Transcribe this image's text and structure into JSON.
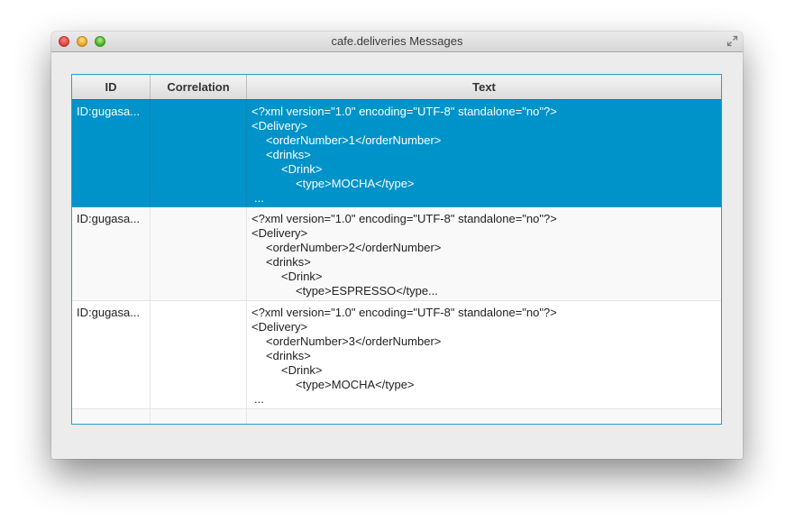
{
  "window": {
    "title": "cafe.deliveries Messages"
  },
  "table": {
    "columns": [
      "ID",
      "Correlation",
      "Text"
    ],
    "rows": [
      {
        "id": "ID:gugasa...",
        "correlation": "",
        "text_lines": [
          "<?xml version=\"1.0\" encoding=\"UTF-8\" standalone=\"no\"?>",
          "<Delivery>",
          "<orderNumber>1</orderNumber>",
          "<drinks>",
          "<Drink>",
          "<type>MOCHA</type>",
          "..."
        ]
      },
      {
        "id": "ID:gugasa...",
        "correlation": "",
        "text_lines": [
          "<?xml version=\"1.0\" encoding=\"UTF-8\" standalone=\"no\"?>",
          "<Delivery>",
          "<orderNumber>2</orderNumber>",
          "<drinks>",
          "<Drink>",
          "<type>ESPRESSO</type..."
        ]
      },
      {
        "id": "ID:gugasa...",
        "correlation": "",
        "text_lines": [
          "<?xml version=\"1.0\" encoding=\"UTF-8\" standalone=\"no\"?>",
          "<Delivery>",
          "<orderNumber>3</orderNumber>",
          "<drinks>",
          "<Drink>",
          "<type>MOCHA</type>",
          "..."
        ]
      }
    ]
  },
  "colors": {
    "selection": "#0093c9",
    "table_border": "#2b9ad0"
  },
  "icons": {
    "close": "close-icon",
    "minimize": "minimize-icon",
    "maximize": "maximize-icon",
    "fullscreen": "fullscreen-icon"
  }
}
